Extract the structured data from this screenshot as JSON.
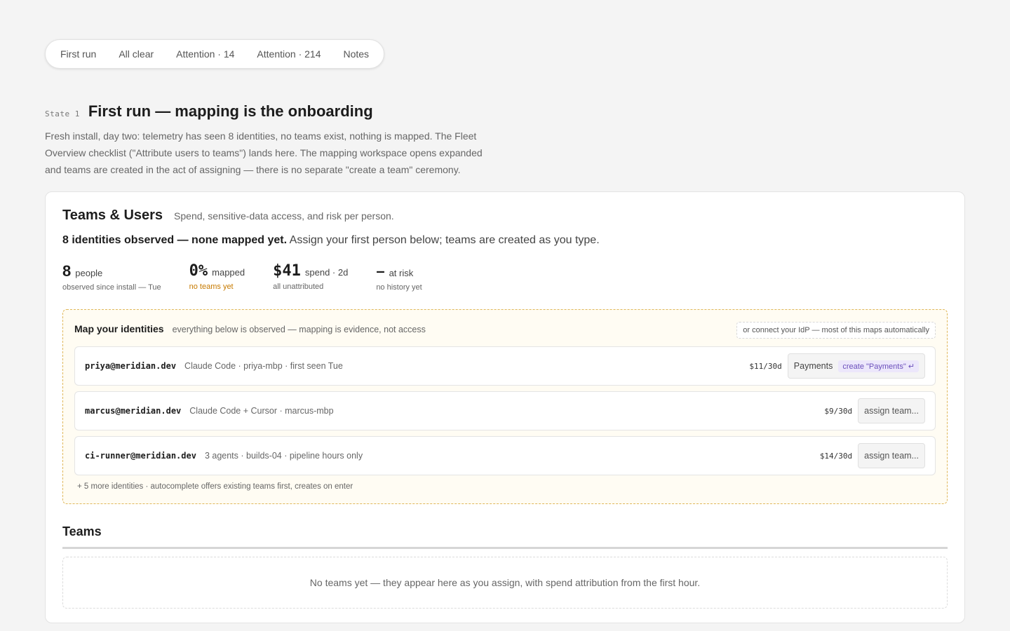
{
  "tabs": [
    "First run",
    "All clear",
    "Attention · 14",
    "Attention · 214",
    "Notes"
  ],
  "state": {
    "tag": "State 1",
    "title": "First run — mapping is the onboarding",
    "description": "Fresh install, day two: telemetry has seen 8 identities, no teams exist, nothing is mapped. The Fleet Overview checklist (\"Attribute users to teams\") lands here. The mapping workspace opens expanded and teams are created in the act of assigning — there is no separate \"create a team\" ceremony."
  },
  "card": {
    "title": "Teams & Users",
    "subtitle": "Spend, sensitive-data access, and risk per person.",
    "headline_bold": "8 identities observed — none mapped yet.",
    "headline_rest": "Assign your first person below; teams are created as you type."
  },
  "stats": [
    {
      "value": "8",
      "label": "people",
      "sub": "observed since install — Tue"
    },
    {
      "value": "0%",
      "label": "mapped",
      "sub": "no teams yet"
    },
    {
      "value": "$41",
      "label": "spend · 2d",
      "sub": "all unattributed"
    },
    {
      "value": "–",
      "label": "at risk",
      "sub": "no history yet"
    }
  ],
  "map": {
    "title": "Map your identities",
    "subtitle": "everything below is observed — mapping is evidence, not access",
    "idp_label": "or connect your IdP — most of this maps automatically",
    "rows": [
      {
        "email": "priya@meridian.dev",
        "desc": "Claude Code · priya-mbp · first seen Tue",
        "spend": "$11/30d",
        "typed": "Payments",
        "suggestion": "create \"Payments\" ↵"
      },
      {
        "email": "marcus@meridian.dev",
        "desc": "Claude Code + Cursor · marcus-mbp",
        "spend": "$9/30d",
        "assign": "assign team..."
      },
      {
        "email": "ci-runner@meridian.dev",
        "desc": "3 agents · builds-04 · pipeline hours only",
        "spend": "$14/30d",
        "assign": "assign team..."
      }
    ],
    "more": "+ 5 more identities · autocomplete offers existing teams first, creates on enter"
  },
  "teams": {
    "title": "Teams",
    "empty": "No teams yet — they appear here as you assign, with spend attribution from the first hour."
  },
  "colors": {
    "accent_warn": "#c77a00",
    "suggest_text": "#6b4fbb",
    "suggest_bg": "#ece7fb",
    "map_border": "#e0b75a",
    "map_bg": "#fffcf3"
  }
}
